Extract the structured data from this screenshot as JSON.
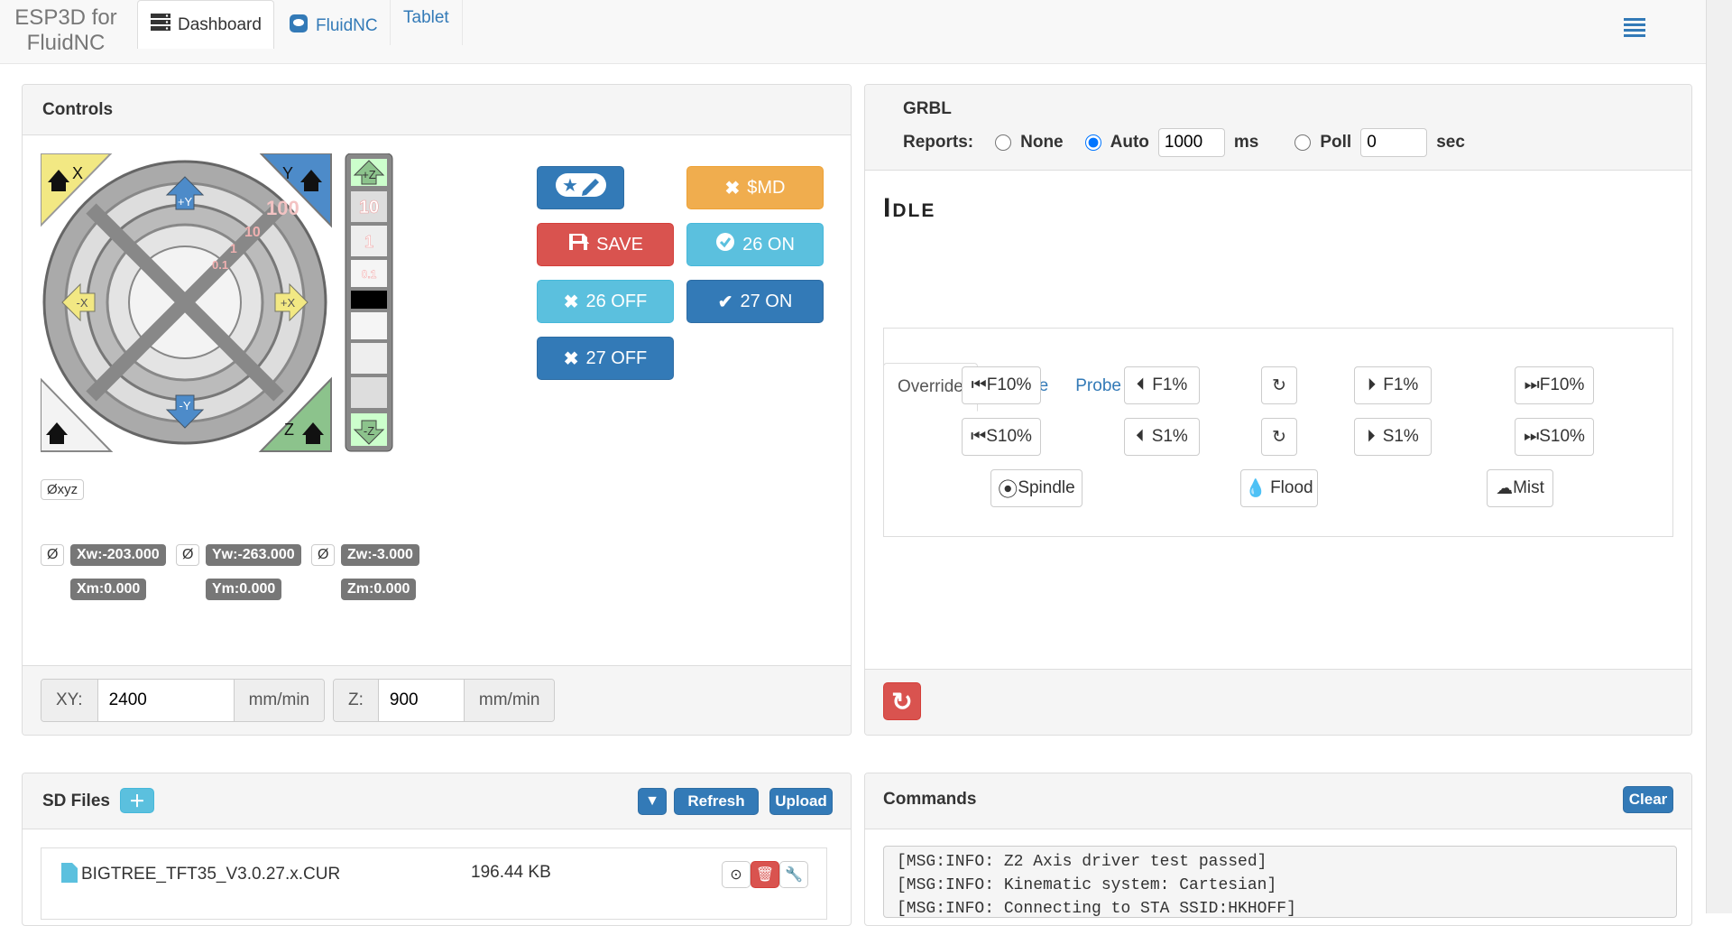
{
  "nav": {
    "brand": "ESP3D for FluidNC",
    "brand_line1": "ESP3D for",
    "brand_line2": "FluidNC",
    "tabs": [
      {
        "label": "Dashboard",
        "icon": "dashboard-icon"
      },
      {
        "label": "FluidNC",
        "icon": "fluidnc-icon"
      },
      {
        "label": "Tablet"
      }
    ],
    "menu_icon": "hamburger-menu-icon"
  },
  "controls": {
    "title": "Controls",
    "jog": {
      "home_x": "X",
      "home_y": "Y",
      "home_z": "Z",
      "plus_y": "+Y",
      "minus_y": "-Y",
      "plus_x": "+X",
      "minus_x": "-X",
      "plus_z": "+Z",
      "minus_z": "-Z",
      "steps": [
        "100",
        "10",
        "1",
        "0.1"
      ],
      "z_steps": [
        "10",
        "1",
        "0.1"
      ]
    },
    "zero_all": "Øxyz",
    "macros": [
      {
        "label": "",
        "icon": "star-pencil-icon",
        "style": "primary"
      },
      {
        "label": "$MD",
        "icon": "times-icon",
        "style": "warning"
      },
      {
        "label": "SAVE",
        "icon": "floppy-icon",
        "style": "danger"
      },
      {
        "label": "26 ON",
        "icon": "check-circle-icon",
        "style": "info"
      },
      {
        "label": "26 OFF",
        "icon": "times-icon",
        "style": "info"
      },
      {
        "label": "27 ON",
        "icon": "check-icon",
        "style": "primary"
      },
      {
        "label": "27 OFF",
        "icon": "times-icon",
        "style": "primary"
      }
    ],
    "positions": {
      "zero_label": "Ø",
      "xw": "Xw:-203.000",
      "yw": "Yw:-263.000",
      "zw": "Zw:-3.000",
      "xm": "Xm:0.000",
      "ym": "Ym:0.000",
      "zm": "Zm:0.000"
    },
    "feed": {
      "xy_label": "XY:",
      "xy_value": "2400",
      "xy_unit": "mm/min",
      "z_label": "Z:",
      "z_value": "900",
      "z_unit": "mm/min"
    }
  },
  "grbl": {
    "title": "GRBL",
    "reports_label": "Reports:",
    "opt_none": "None",
    "opt_auto": "Auto",
    "auto_value": "1000",
    "auto_unit": "ms",
    "opt_poll": "Poll",
    "poll_value": "0",
    "poll_unit": "sec",
    "selected": "Auto",
    "state": "Idle",
    "tabs": [
      "Override",
      "Spindle",
      "Probe"
    ],
    "active_tab": "Override",
    "overrides": {
      "f_minus10": "F10%",
      "f_minus1": "F1%",
      "f_plus1": "F1%",
      "f_plus10": "F10%",
      "s_minus10": "S10%",
      "s_minus1": "S1%",
      "s_plus1": "S1%",
      "s_plus10": "S10%",
      "spindle": "Spindle",
      "flood": "Flood",
      "mist": "Mist"
    },
    "reset_icon": "reset-icon",
    "accent_red": "#d9534f"
  },
  "sdfiles": {
    "title": "SD Files",
    "filter_icon": "filter-icon",
    "refresh": "Refresh",
    "upload": "Upload",
    "files": [
      {
        "name": "BIGTREE_TFT35_V3.0.27.x.CUR",
        "size": "196.44 KB"
      }
    ]
  },
  "commands": {
    "title": "Commands",
    "clear": "Clear",
    "lines": [
      "[MSG:INFO: Z2 Axis driver test passed]",
      "[MSG:INFO: Kinematic system: Cartesian]",
      "[MSG:INFO: Connecting to STA SSID:HKHOFF]"
    ]
  }
}
